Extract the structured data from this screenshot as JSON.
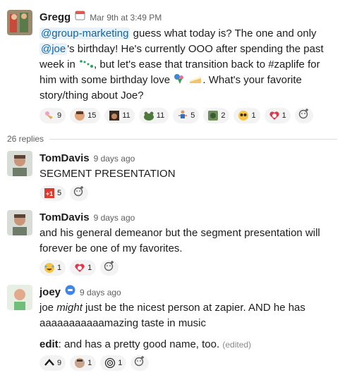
{
  "messages": [
    {
      "author": "Gregg",
      "timestamp": "Mar 9th at 3:49 PM",
      "text_parts": {
        "mention1": "@group-marketing",
        "t1": " guess what today is? The one and only ",
        "mention2": "@joe",
        "t2": "'s birthday! He's currently OOO after spending the past week in ",
        "t3": ", but let's ease that transition back to #zaplife for him with some birthday love ",
        "t4": ".  What's your favorite story/thing about Joe?"
      },
      "reactions": [
        {
          "icon": "ice-cream-icon",
          "count": "9"
        },
        {
          "icon": "face-icon",
          "count": "15"
        },
        {
          "icon": "person-icon",
          "count": "11"
        },
        {
          "icon": "frog-icon",
          "count": "11"
        },
        {
          "icon": "dancer-icon",
          "count": "5"
        },
        {
          "icon": "zombie-icon",
          "count": "2"
        },
        {
          "icon": "pleading-face-icon",
          "count": "1"
        },
        {
          "icon": "heart-face-icon",
          "count": "1"
        }
      ]
    },
    {
      "author": "TomDavis",
      "timestamp": "9 days ago",
      "text": "SEGMENT PRESENTATION",
      "reactions": [
        {
          "icon": "plus-one-icon",
          "count": "5"
        }
      ]
    },
    {
      "author": "TomDavis",
      "timestamp": "9 days ago",
      "text": "and his general demeanor but the segment presentation will forever be one of my favorites.",
      "reactions": [
        {
          "icon": "laughing-icon",
          "count": "1"
        },
        {
          "icon": "heart-face-icon",
          "count": "1"
        }
      ]
    },
    {
      "author": "joey",
      "timestamp": "9 days ago",
      "text_a": "joe ",
      "text_em": "might",
      "text_b": " just be the nicest person at zapier. AND he has aaaaaaaaaaamazing taste in music",
      "text2_bold": "edit",
      "text2": ": and has a pretty good name, too.",
      "edited": "(edited)",
      "reactions": [
        {
          "icon": "chevron-up-icon",
          "count": "9"
        },
        {
          "icon": "face-icon",
          "count": "1"
        },
        {
          "icon": "spiral-icon",
          "count": "1"
        }
      ]
    }
  ],
  "replies_label": "26 replies"
}
